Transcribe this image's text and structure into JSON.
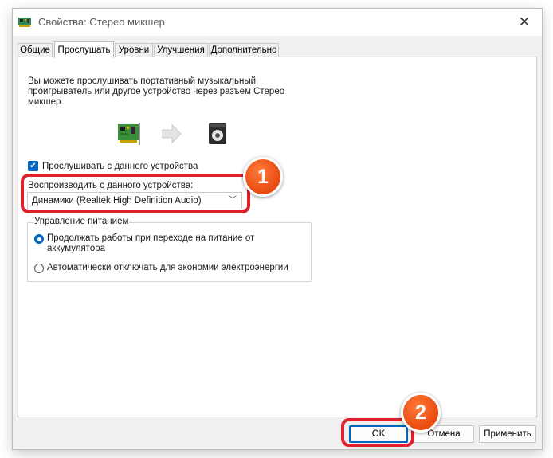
{
  "window": {
    "title": "Свойства: Стерео микшер",
    "close_icon": "close-icon"
  },
  "tabs": [
    {
      "label": "Общие"
    },
    {
      "label": "Прослушать"
    },
    {
      "label": "Уровни"
    },
    {
      "label": "Улучшения"
    },
    {
      "label": "Дополнительно"
    }
  ],
  "listen": {
    "description": "Вы можете прослушивать портативный музыкальный проигрыватель или другое устройство через разъем Стерео микшер.",
    "listen_checkbox_label": "Прослушивать с данного устройства",
    "listen_checked": true,
    "playback_label": "Воспроизводить с данного устройства:",
    "playback_device": "Динамики (Realtek High Definition Audio)"
  },
  "power": {
    "group_label": "Управление питанием",
    "options": [
      {
        "label": "Продолжать работы при переходе на питание от аккумулятора",
        "selected": true
      },
      {
        "label": "Автоматически отключать для экономии электроэнергии",
        "selected": false
      }
    ]
  },
  "buttons": {
    "ok": "OK",
    "cancel": "Отмена",
    "apply": "Применить"
  },
  "annotations": {
    "badge1": "1",
    "badge2": "2"
  },
  "colors": {
    "accent": "#0067c0",
    "highlight": "#e0202a",
    "badge": "#e84a10"
  }
}
